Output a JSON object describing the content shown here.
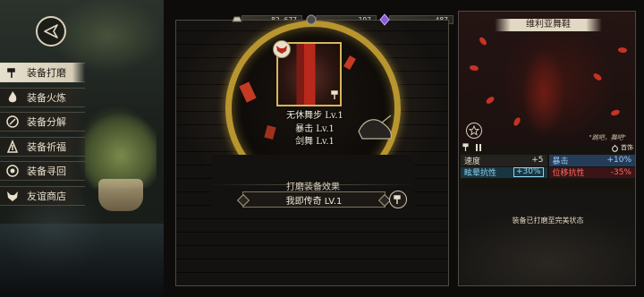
{
  "resources": [
    {
      "name": "silver",
      "icon": "silver-ingot-icon",
      "value": "82,677"
    },
    {
      "name": "orb",
      "icon": "dark-orb-icon",
      "value": "197"
    },
    {
      "name": "crystal",
      "icon": "purple-crystal-icon",
      "value": "487"
    }
  ],
  "sidebar": {
    "items": [
      {
        "label": "装备打磨",
        "icon": "hammer-icon",
        "active": true
      },
      {
        "label": "装备火炼",
        "icon": "flame-icon",
        "active": false
      },
      {
        "label": "装备分解",
        "icon": "disassemble-icon",
        "active": false
      },
      {
        "label": "装备祈福",
        "icon": "pray-icon",
        "active": false
      },
      {
        "label": "装备寻回",
        "icon": "retrieve-icon",
        "active": false
      },
      {
        "label": "友谊商店",
        "icon": "fox-shop-icon",
        "active": false
      }
    ]
  },
  "center": {
    "skills": [
      "无休舞步 Lv.1",
      "暴击 Lv.1",
      "剑舞 Lv.1"
    ],
    "enhance_title": "打磨装备效果",
    "enhance_effect": "我即传奇 LV.1"
  },
  "character": {
    "name": "维利亚舞鞋",
    "quote": "\"跳吧，舞吧\"",
    "stat_header_right": "首饰",
    "stats": [
      [
        {
          "label": "速度",
          "value": "+5",
          "style": "dark"
        },
        {
          "label": "暴击",
          "value": "+10%",
          "style": "blue"
        }
      ],
      [
        {
          "label": "眩晕抗性",
          "value": "+30%",
          "style": "teal"
        },
        {
          "label": "位移抗性",
          "value": "-35%",
          "style": "pink"
        }
      ]
    ],
    "status": "装备已打磨至完美状态"
  },
  "colors": {
    "gold": "#b8952f",
    "active_menu": "#e6dfcd",
    "buff_blue": "#9ecaf5",
    "debuff_red": "#ff6a60"
  }
}
